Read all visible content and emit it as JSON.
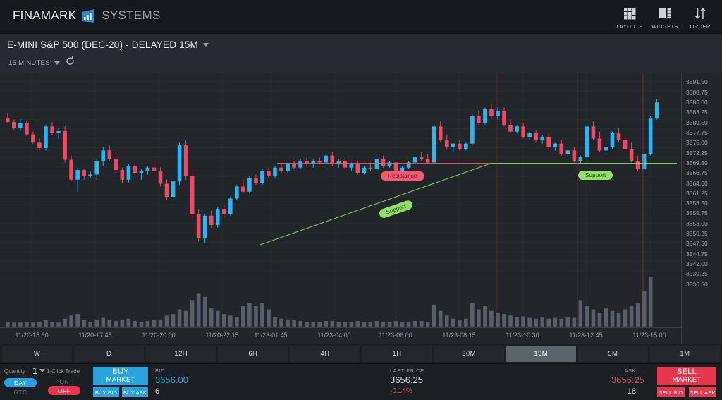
{
  "brand": {
    "part1": "FINAMARK",
    "part2": "SYSTEMS",
    "logo_icon": "bar-chart-logo-icon"
  },
  "topbar": {
    "items": [
      {
        "label": "LAYOUTS",
        "icon": "grid-layout-icon"
      },
      {
        "label": "WIDGETS",
        "icon": "widgets-icon"
      },
      {
        "label": "ORDER",
        "icon": "order-arrows-icon"
      }
    ]
  },
  "chart_header": {
    "symbol": "E-MINI S&P 500 (DEC-20) - DELAYED 15M",
    "symbol_chevron": "chevron-down-icon",
    "timeframe_label": "15 MINUTES",
    "timeframe_chevron": "chevron-down-icon",
    "refresh_icon": "refresh-icon",
    "tools": [
      {
        "name": "crosshair-tool-icon"
      },
      {
        "name": "magnet-tool-icon"
      },
      {
        "name": "line-chart-tool-icon"
      },
      {
        "name": "layers-tool-icon"
      },
      {
        "name": "calendar-tool-icon"
      },
      {
        "name": "settings-gear-icon"
      }
    ],
    "window_buttons": [
      {
        "name": "save-icon"
      },
      {
        "name": "close-icon"
      }
    ]
  },
  "chart_data": {
    "type": "candlestick",
    "title": "E-MINI S&P 500 (DEC-20) - DELAYED 15M",
    "xlabel": "",
    "ylabel": "",
    "ylim": [
      3535.0,
      3593.0
    ],
    "grid": true,
    "legend": "none",
    "x_tick_labels": [
      "11/20-15:30",
      "11/20-17:45",
      "11/20-20:00",
      "11/20-22:15",
      "11/23-01:45",
      "11/23-04:00",
      "11/23-06:00",
      "11/23-08:15",
      "11/23-10:30",
      "11/23-12:45",
      "11/23-15:00"
    ],
    "x_tick_positions": [
      75,
      225,
      375,
      525,
      640,
      790,
      935,
      1085,
      1235,
      1385,
      1535
    ],
    "y_tick_labels": [
      "3591.50",
      "3588.75",
      "3586.00",
      "3583.25",
      "3580.50",
      "3577.75",
      "3575.00",
      "3572.25",
      "3569.50",
      "3566.75",
      "3564.00",
      "3561.25",
      "3558.50",
      "3555.75",
      "3553.00",
      "3550.25",
      "3547.50",
      "3544.75",
      "3542.00",
      "3539.25",
      "3536.50"
    ],
    "colors": {
      "up": "#29b6f6",
      "down": "#ef4a62",
      "volume": "#6b7280",
      "background": "#22262b",
      "grid": "#2c3137"
    },
    "annotations": [
      {
        "label": "Resistance",
        "type": "horizontal-line",
        "color": "#f05b74",
        "price": 3566.75
      },
      {
        "label": "Support",
        "type": "trendline",
        "color": "#92e06a"
      },
      {
        "label": "Support",
        "type": "horizontal-line",
        "color": "#92e06a",
        "price": 3566.75
      }
    ],
    "candles": [
      {
        "o": 3580.0,
        "h": 3581.5,
        "l": 3578.5,
        "c": 3578.8
      },
      {
        "o": 3578.8,
        "h": 3579.5,
        "l": 3576.5,
        "c": 3577.0
      },
      {
        "o": 3577.0,
        "h": 3579.8,
        "l": 3576.2,
        "c": 3578.6
      },
      {
        "o": 3578.6,
        "h": 3579.0,
        "l": 3574.8,
        "c": 3575.2
      },
      {
        "o": 3575.2,
        "h": 3576.0,
        "l": 3572.5,
        "c": 3573.0
      },
      {
        "o": 3573.0,
        "h": 3574.2,
        "l": 3570.8,
        "c": 3571.2
      },
      {
        "o": 3571.2,
        "h": 3578.0,
        "l": 3570.5,
        "c": 3577.5
      },
      {
        "o": 3577.5,
        "h": 3578.8,
        "l": 3575.0,
        "c": 3575.6
      },
      {
        "o": 3575.6,
        "h": 3577.0,
        "l": 3574.0,
        "c": 3576.2
      },
      {
        "o": 3576.2,
        "h": 3577.5,
        "l": 3567.0,
        "c": 3567.8
      },
      {
        "o": 3567.8,
        "h": 3569.0,
        "l": 3561.5,
        "c": 3562.0
      },
      {
        "o": 3562.0,
        "h": 3565.5,
        "l": 3558.5,
        "c": 3564.8
      },
      {
        "o": 3564.8,
        "h": 3565.2,
        "l": 3562.0,
        "c": 3563.0
      },
      {
        "o": 3563.0,
        "h": 3564.5,
        "l": 3562.5,
        "c": 3563.5
      },
      {
        "o": 3563.5,
        "h": 3568.0,
        "l": 3562.0,
        "c": 3567.5
      },
      {
        "o": 3567.5,
        "h": 3571.5,
        "l": 3566.0,
        "c": 3570.5
      },
      {
        "o": 3570.5,
        "h": 3572.0,
        "l": 3567.5,
        "c": 3568.0
      },
      {
        "o": 3568.0,
        "h": 3569.0,
        "l": 3564.0,
        "c": 3564.8
      },
      {
        "o": 3564.8,
        "h": 3565.5,
        "l": 3561.0,
        "c": 3562.0
      },
      {
        "o": 3562.0,
        "h": 3566.5,
        "l": 3561.2,
        "c": 3566.0
      },
      {
        "o": 3566.0,
        "h": 3567.0,
        "l": 3563.5,
        "c": 3564.0
      },
      {
        "o": 3564.0,
        "h": 3565.0,
        "l": 3562.0,
        "c": 3564.5
      },
      {
        "o": 3564.5,
        "h": 3566.0,
        "l": 3563.5,
        "c": 3565.5
      },
      {
        "o": 3565.5,
        "h": 3567.5,
        "l": 3564.0,
        "c": 3564.5
      },
      {
        "o": 3564.5,
        "h": 3565.5,
        "l": 3560.0,
        "c": 3560.8
      },
      {
        "o": 3560.8,
        "h": 3562.0,
        "l": 3556.0,
        "c": 3557.0
      },
      {
        "o": 3557.0,
        "h": 3562.0,
        "l": 3556.0,
        "c": 3561.5
      },
      {
        "o": 3561.5,
        "h": 3573.0,
        "l": 3560.5,
        "c": 3572.0
      },
      {
        "o": 3572.0,
        "h": 3573.5,
        "l": 3562.0,
        "c": 3563.0
      },
      {
        "o": 3563.0,
        "h": 3564.5,
        "l": 3551.0,
        "c": 3552.0
      },
      {
        "o": 3552.0,
        "h": 3553.5,
        "l": 3544.0,
        "c": 3545.0
      },
      {
        "o": 3545.0,
        "h": 3552.0,
        "l": 3543.5,
        "c": 3551.5
      },
      {
        "o": 3551.5,
        "h": 3553.0,
        "l": 3548.0,
        "c": 3548.8
      },
      {
        "o": 3548.8,
        "h": 3554.0,
        "l": 3548.0,
        "c": 3553.5
      },
      {
        "o": 3553.5,
        "h": 3554.5,
        "l": 3551.0,
        "c": 3552.0
      },
      {
        "o": 3552.0,
        "h": 3557.0,
        "l": 3551.5,
        "c": 3556.5
      },
      {
        "o": 3556.5,
        "h": 3560.5,
        "l": 3556.0,
        "c": 3560.0
      },
      {
        "o": 3560.0,
        "h": 3562.0,
        "l": 3558.0,
        "c": 3558.5
      },
      {
        "o": 3558.5,
        "h": 3563.0,
        "l": 3558.0,
        "c": 3562.5
      },
      {
        "o": 3562.5,
        "h": 3563.5,
        "l": 3560.5,
        "c": 3561.0
      },
      {
        "o": 3561.0,
        "h": 3565.0,
        "l": 3560.5,
        "c": 3564.5
      },
      {
        "o": 3564.5,
        "h": 3565.5,
        "l": 3562.5,
        "c": 3563.0
      },
      {
        "o": 3563.0,
        "h": 3566.0,
        "l": 3562.5,
        "c": 3565.5
      },
      {
        "o": 3565.5,
        "h": 3566.5,
        "l": 3564.0,
        "c": 3564.5
      },
      {
        "o": 3564.5,
        "h": 3567.0,
        "l": 3564.0,
        "c": 3566.5
      },
      {
        "o": 3566.5,
        "h": 3567.5,
        "l": 3565.0,
        "c": 3565.5
      },
      {
        "o": 3565.5,
        "h": 3568.0,
        "l": 3565.0,
        "c": 3567.5
      },
      {
        "o": 3567.5,
        "h": 3568.5,
        "l": 3566.0,
        "c": 3566.5
      },
      {
        "o": 3566.5,
        "h": 3568.0,
        "l": 3565.5,
        "c": 3567.5
      },
      {
        "o": 3567.5,
        "h": 3568.5,
        "l": 3566.5,
        "c": 3567.0
      },
      {
        "o": 3567.0,
        "h": 3569.5,
        "l": 3566.5,
        "c": 3569.0
      },
      {
        "o": 3569.0,
        "h": 3570.0,
        "l": 3566.0,
        "c": 3566.5
      },
      {
        "o": 3566.5,
        "h": 3568.0,
        "l": 3565.5,
        "c": 3567.5
      },
      {
        "o": 3567.5,
        "h": 3568.5,
        "l": 3565.0,
        "c": 3565.5
      },
      {
        "o": 3565.5,
        "h": 3567.0,
        "l": 3564.5,
        "c": 3566.5
      },
      {
        "o": 3566.5,
        "h": 3567.5,
        "l": 3563.5,
        "c": 3564.0
      },
      {
        "o": 3564.0,
        "h": 3566.0,
        "l": 3563.5,
        "c": 3565.5
      },
      {
        "o": 3565.5,
        "h": 3567.0,
        "l": 3564.5,
        "c": 3565.0
      },
      {
        "o": 3565.0,
        "h": 3568.5,
        "l": 3564.5,
        "c": 3568.0
      },
      {
        "o": 3568.0,
        "h": 3569.0,
        "l": 3565.5,
        "c": 3566.0
      },
      {
        "o": 3566.0,
        "h": 3567.5,
        "l": 3565.5,
        "c": 3567.0
      },
      {
        "o": 3567.0,
        "h": 3568.0,
        "l": 3564.0,
        "c": 3564.5
      },
      {
        "o": 3564.5,
        "h": 3566.0,
        "l": 3563.5,
        "c": 3565.5
      },
      {
        "o": 3565.5,
        "h": 3567.5,
        "l": 3565.0,
        "c": 3567.0
      },
      {
        "o": 3567.0,
        "h": 3569.0,
        "l": 3566.5,
        "c": 3568.5
      },
      {
        "o": 3568.5,
        "h": 3570.0,
        "l": 3567.5,
        "c": 3568.0
      },
      {
        "o": 3568.0,
        "h": 3569.5,
        "l": 3566.5,
        "c": 3567.0
      },
      {
        "o": 3567.0,
        "h": 3578.0,
        "l": 3566.5,
        "c": 3577.5
      },
      {
        "o": 3577.5,
        "h": 3579.0,
        "l": 3573.0,
        "c": 3573.5
      },
      {
        "o": 3573.5,
        "h": 3575.0,
        "l": 3571.0,
        "c": 3571.5
      },
      {
        "o": 3571.5,
        "h": 3573.0,
        "l": 3570.0,
        "c": 3572.5
      },
      {
        "o": 3572.5,
        "h": 3573.5,
        "l": 3570.5,
        "c": 3571.0
      },
      {
        "o": 3571.0,
        "h": 3573.0,
        "l": 3570.5,
        "c": 3572.5
      },
      {
        "o": 3572.5,
        "h": 3581.0,
        "l": 3572.0,
        "c": 3580.5
      },
      {
        "o": 3580.5,
        "h": 3582.0,
        "l": 3578.0,
        "c": 3578.5
      },
      {
        "o": 3578.5,
        "h": 3583.0,
        "l": 3578.0,
        "c": 3582.5
      },
      {
        "o": 3582.5,
        "h": 3584.0,
        "l": 3580.0,
        "c": 3580.5
      },
      {
        "o": 3580.5,
        "h": 3583.0,
        "l": 3579.5,
        "c": 3582.0
      },
      {
        "o": 3582.0,
        "h": 3583.0,
        "l": 3577.5,
        "c": 3578.0
      },
      {
        "o": 3578.0,
        "h": 3579.5,
        "l": 3575.5,
        "c": 3576.0
      },
      {
        "o": 3576.0,
        "h": 3578.0,
        "l": 3575.5,
        "c": 3577.5
      },
      {
        "o": 3577.5,
        "h": 3578.5,
        "l": 3574.0,
        "c": 3574.5
      },
      {
        "o": 3574.5,
        "h": 3576.0,
        "l": 3573.5,
        "c": 3575.5
      },
      {
        "o": 3575.5,
        "h": 3576.5,
        "l": 3573.0,
        "c": 3573.5
      },
      {
        "o": 3573.5,
        "h": 3575.0,
        "l": 3572.5,
        "c": 3574.5
      },
      {
        "o": 3574.5,
        "h": 3575.5,
        "l": 3571.0,
        "c": 3571.5
      },
      {
        "o": 3571.5,
        "h": 3573.0,
        "l": 3570.5,
        "c": 3572.5
      },
      {
        "o": 3572.5,
        "h": 3573.5,
        "l": 3569.0,
        "c": 3569.5
      },
      {
        "o": 3569.5,
        "h": 3571.0,
        "l": 3568.5,
        "c": 3570.5
      },
      {
        "o": 3570.5,
        "h": 3571.5,
        "l": 3567.0,
        "c": 3567.5
      },
      {
        "o": 3567.5,
        "h": 3569.0,
        "l": 3566.5,
        "c": 3568.5
      },
      {
        "o": 3568.5,
        "h": 3578.0,
        "l": 3568.0,
        "c": 3577.5
      },
      {
        "o": 3577.5,
        "h": 3579.0,
        "l": 3573.5,
        "c": 3574.0
      },
      {
        "o": 3574.0,
        "h": 3576.0,
        "l": 3570.0,
        "c": 3570.5
      },
      {
        "o": 3570.5,
        "h": 3572.0,
        "l": 3569.0,
        "c": 3571.5
      },
      {
        "o": 3571.5,
        "h": 3576.0,
        "l": 3571.0,
        "c": 3575.5
      },
      {
        "o": 3575.5,
        "h": 3577.0,
        "l": 3573.0,
        "c": 3573.5
      },
      {
        "o": 3573.5,
        "h": 3575.0,
        "l": 3570.5,
        "c": 3571.0
      },
      {
        "o": 3571.0,
        "h": 3573.0,
        "l": 3567.0,
        "c": 3567.5
      },
      {
        "o": 3567.5,
        "h": 3569.0,
        "l": 3564.5,
        "c": 3565.0
      },
      {
        "o": 3565.0,
        "h": 3570.0,
        "l": 3564.5,
        "c": 3569.5
      },
      {
        "o": 3569.5,
        "h": 3580.5,
        "l": 3569.0,
        "c": 3580.0
      },
      {
        "o": 3580.0,
        "h": 3585.5,
        "l": 3579.5,
        "c": 3584.5
      }
    ],
    "volumes": [
      6,
      5,
      5,
      6,
      5,
      6,
      8,
      6,
      5,
      10,
      14,
      16,
      8,
      6,
      9,
      11,
      8,
      7,
      8,
      10,
      7,
      6,
      7,
      8,
      9,
      14,
      16,
      22,
      20,
      34,
      42,
      38,
      24,
      20,
      16,
      14,
      12,
      26,
      30,
      26,
      30,
      22,
      12,
      10,
      9,
      8,
      7,
      6,
      6,
      6,
      7,
      7,
      6,
      6,
      6,
      7,
      6,
      6,
      7,
      6,
      6,
      7,
      6,
      6,
      7,
      7,
      6,
      28,
      20,
      14,
      10,
      9,
      10,
      30,
      22,
      26,
      20,
      18,
      16,
      14,
      12,
      13,
      11,
      10,
      12,
      10,
      11,
      10,
      12,
      11,
      34,
      26,
      22,
      18,
      24,
      20,
      18,
      22,
      26,
      30,
      46,
      64
    ]
  },
  "timeframes": {
    "items": [
      "W",
      "D",
      "12H",
      "6H",
      "4H",
      "1H",
      "30M",
      "15M",
      "5M",
      "1M"
    ],
    "selected": "15M"
  },
  "trade_panel": {
    "quantity_label": "Quantity",
    "quantity_value": "1",
    "quantity_chevron": "chevron-down-icon",
    "duration": {
      "day": "DAY",
      "gtc": "GTC",
      "selected": "DAY"
    },
    "one_click_label": "1-Click Trade",
    "one_click": {
      "on": "ON",
      "off": "OFF",
      "selected": "OFF"
    },
    "buy_market_l1": "BUY",
    "buy_market_l2": "MARKET",
    "buy_bid": "BUY BID",
    "buy_ask": "BUY ASK",
    "bid_label": "BID",
    "bid_value": "3656.00",
    "bid_size": "6",
    "last_label": "LAST PRICE",
    "last_value": "3656.25",
    "last_change": "-0.14%",
    "ask_label": "ASK",
    "ask_value": "3656.25",
    "ask_size": "18",
    "sell_market_l1": "SELL",
    "sell_market_l2": "MARKET",
    "sell_bid": "SELL BID",
    "sell_ask": "SELL ASK"
  },
  "colors": {
    "accent_blue": "#29a3e0",
    "accent_red": "#e8364f",
    "up": "#29b6f6",
    "down": "#ef4a62",
    "support": "#92e06a",
    "resistance": "#f05b74"
  }
}
